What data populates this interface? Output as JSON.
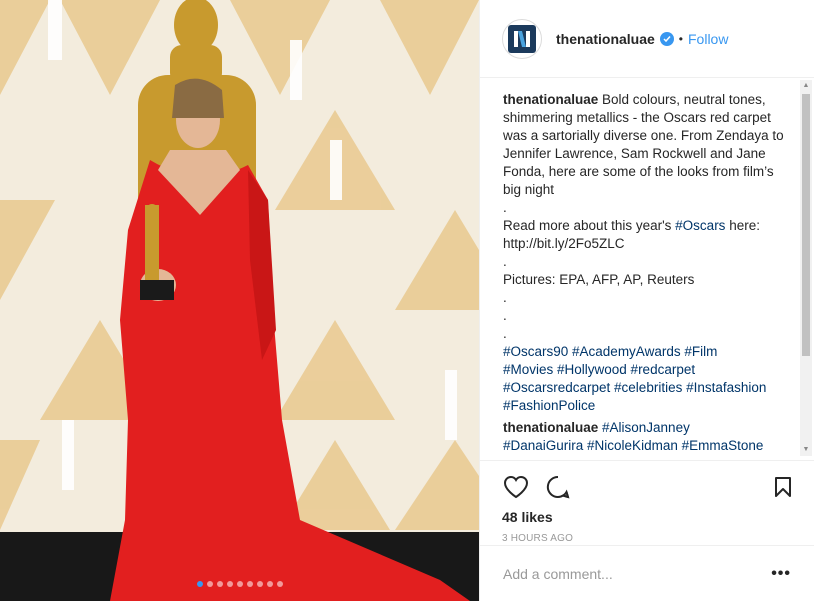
{
  "post": {
    "username": "thenationaluae",
    "follow_label": "Follow",
    "bullet": "•",
    "image_alt_subject": "woman in red gown holding Oscar statuette",
    "carousel": {
      "count": 9,
      "active_index": 0
    }
  },
  "comments": [
    {
      "user": "thenationaluae",
      "text": " Bold colours, neutral tones, shimmering metallics - the Oscars red carpet was a sartorially diverse one. From Zendaya to Jennifer Lawrence, Sam Rockwell and Jane Fonda, here are some of the looks from film’s big night\n.\nRead more about this year's ",
      "tag1": "#Oscars",
      "text2": " here:\nhttp://bit.ly/2Fo5ZLC\n.\nPictures: EPA, AFP, AP, Reuters\n.\n.\n.\n",
      "tags": "#Oscars90 #AcademyAwards #Film\n#Movies #Hollywood #redcarpet\n#Oscarsredcarpet #celebrities #Instafashion\n#FashionPolice"
    },
    {
      "user": "thenationaluae",
      "tags": " #AlisonJanney\n#DanaiGurira #NicoleKidman #EmmaStone"
    }
  ],
  "actions": {
    "likes": "48 likes",
    "time": "3 HOURS AGO",
    "comment_placeholder": "Add a comment...",
    "more": "•••"
  },
  "colors": {
    "accent": "#3897f0",
    "hashtag": "#003569",
    "dress_red": "#e21f1f",
    "statue_gold": "#c89a2e"
  },
  "icons": [
    "heart-icon",
    "comment-icon",
    "bookmark-icon",
    "verified-badge-icon"
  ]
}
